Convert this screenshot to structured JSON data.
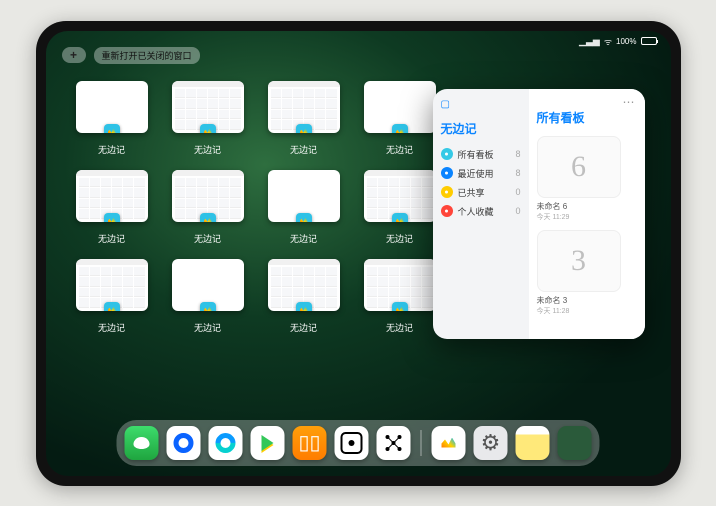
{
  "status": {
    "battery_label": "100%"
  },
  "top": {
    "plus": "+",
    "reopen_label": "重新打开已关闭的窗口"
  },
  "windows": {
    "label": "无边记",
    "items": [
      {
        "variant": "blank"
      },
      {
        "variant": "tabs"
      },
      {
        "variant": "tabs"
      },
      {
        "variant": "blank"
      },
      {
        "variant": "tabs"
      },
      {
        "variant": "tabs"
      },
      {
        "variant": "blank"
      },
      {
        "variant": "tabs"
      },
      {
        "variant": "tabs"
      },
      {
        "variant": "blank"
      },
      {
        "variant": "tabs"
      },
      {
        "variant": "tabs"
      }
    ]
  },
  "popover": {
    "left_title": "无边记",
    "right_title": "所有看板",
    "categories": [
      {
        "label": "所有看板",
        "count": "8",
        "icon_color": "#35c9e6"
      },
      {
        "label": "最近使用",
        "count": "8",
        "icon_color": "#0a84ff"
      },
      {
        "label": "已共享",
        "count": "0",
        "icon_color": "#ffcc00"
      },
      {
        "label": "个人收藏",
        "count": "0",
        "icon_color": "#ff453a"
      }
    ],
    "boards": [
      {
        "glyph": "6",
        "name": "未命名 6",
        "date": "今天 11:29"
      },
      {
        "glyph": "3",
        "name": "未命名 3",
        "date": "今天 11:28"
      }
    ]
  },
  "dock": {
    "items": [
      {
        "name": "wechat"
      },
      {
        "name": "q1"
      },
      {
        "name": "q2"
      },
      {
        "name": "play"
      },
      {
        "name": "books"
      },
      {
        "name": "dot"
      },
      {
        "name": "nodes"
      },
      {
        "name": "freeform"
      },
      {
        "name": "settings"
      },
      {
        "name": "notes"
      },
      {
        "name": "applib"
      }
    ]
  }
}
